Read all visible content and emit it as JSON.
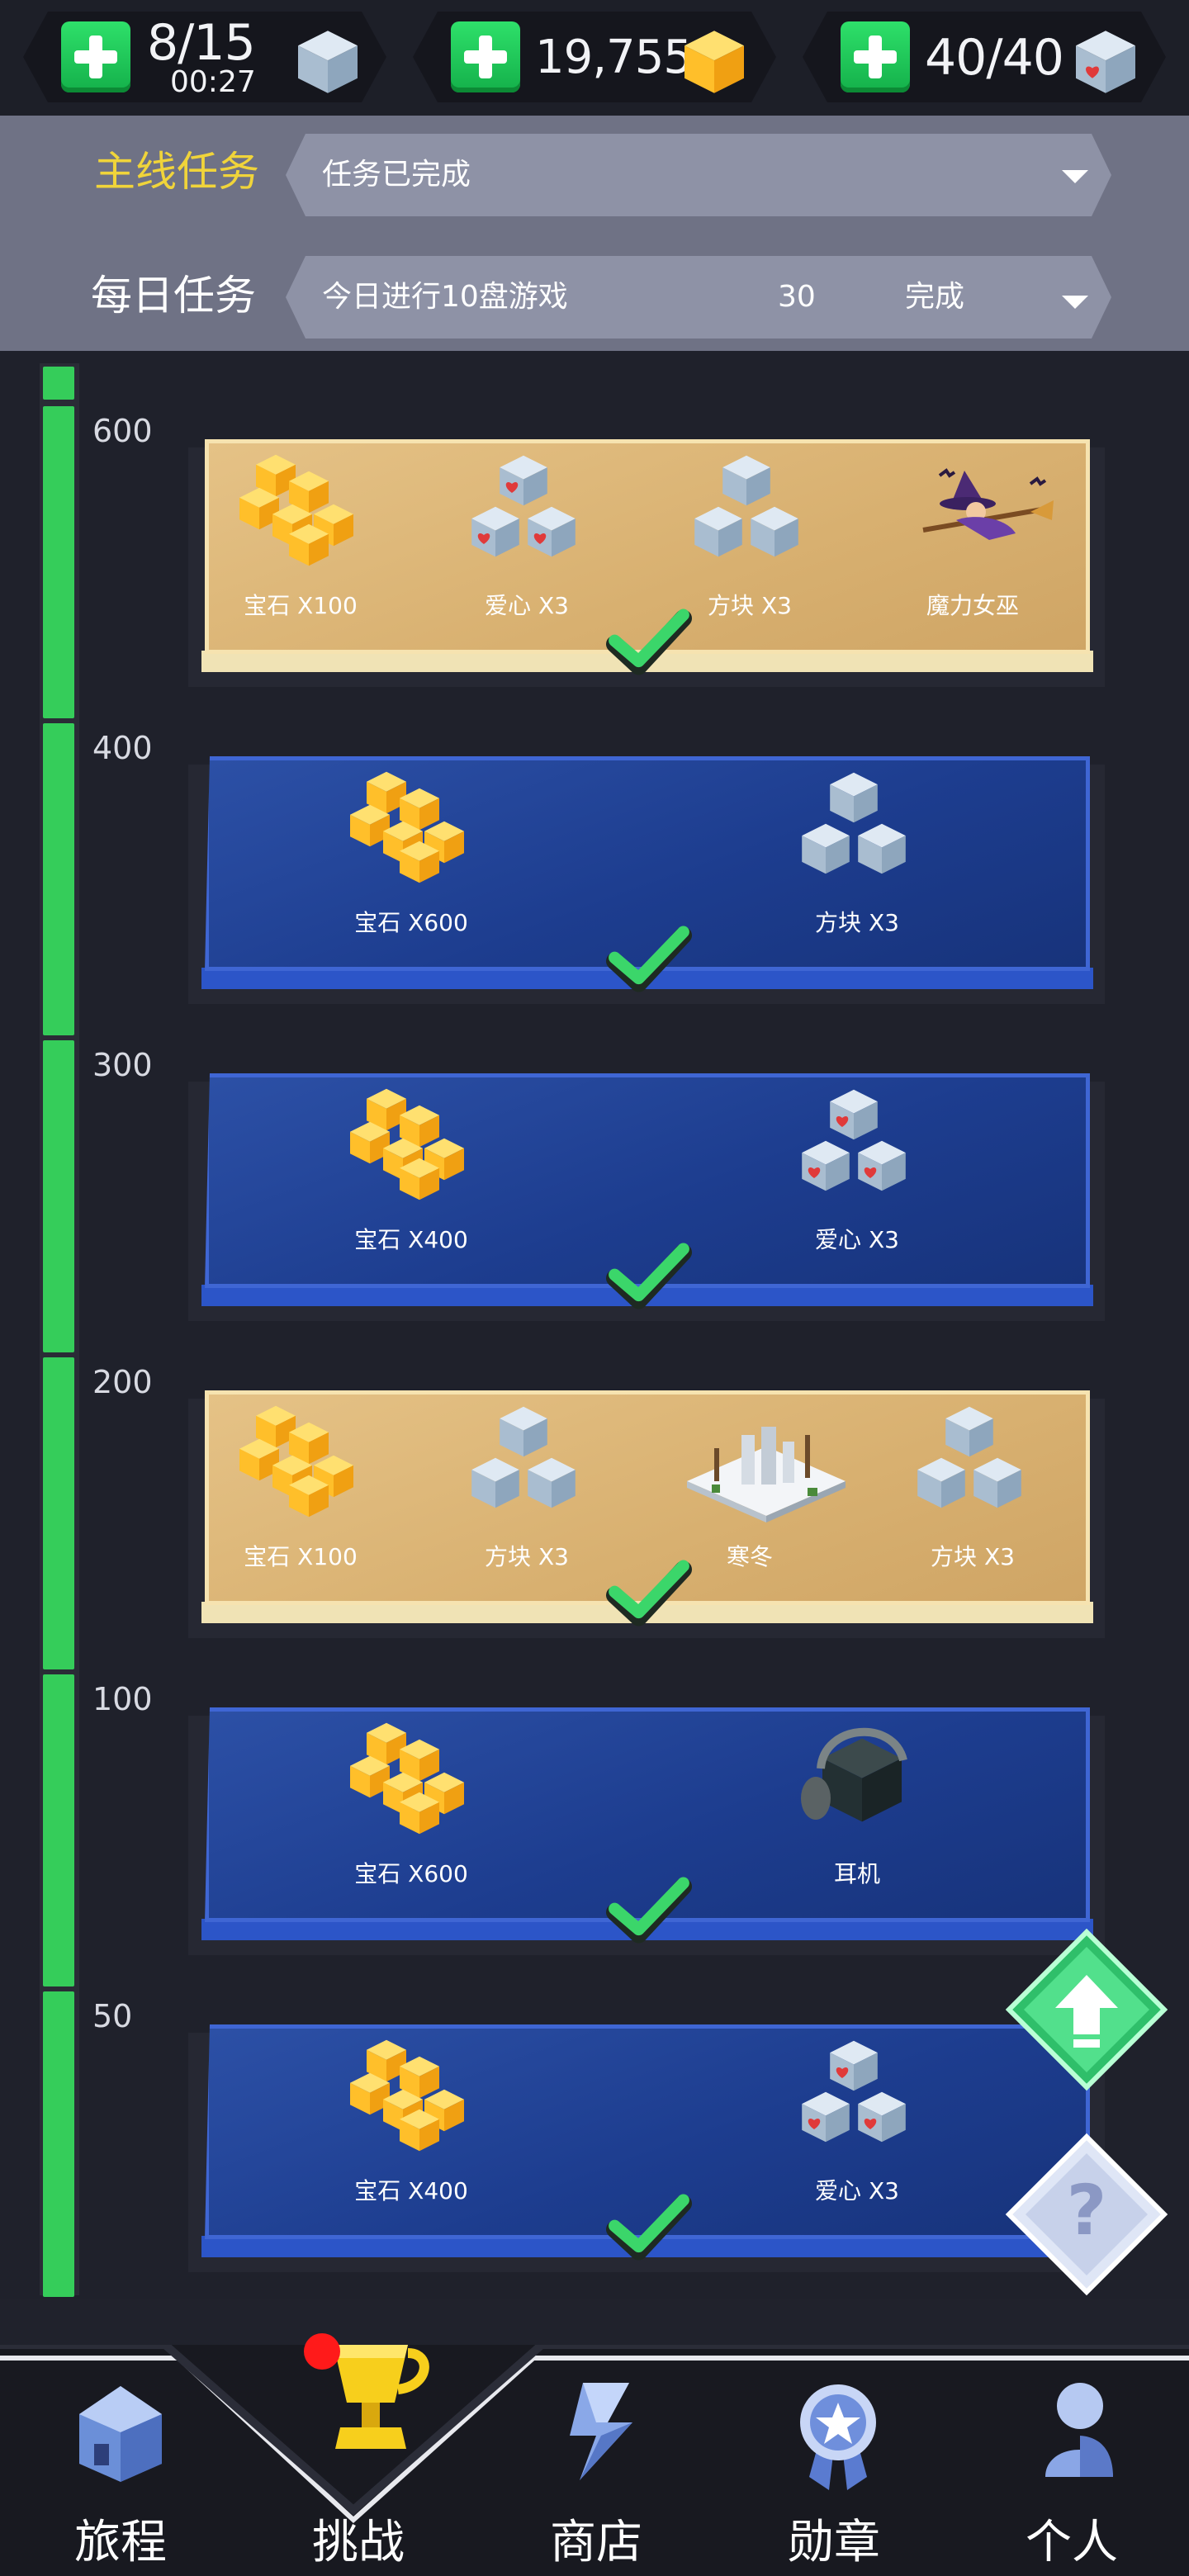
{
  "status_bar": {
    "energy": {
      "value": "8/15",
      "timer": "00:27",
      "icon": "ice-cube-icon"
    },
    "gems": {
      "value": "19,755",
      "icon": "gold-gem-icon"
    },
    "hearts": {
      "value": "40/40",
      "icon": "heart-cube-icon"
    }
  },
  "tasks": {
    "main": {
      "label": "主线任务",
      "status": "任务已完成"
    },
    "daily": {
      "label": "每日任务",
      "status": "今日进行10盘游戏",
      "count": "30",
      "state": "完成"
    }
  },
  "colors": {
    "accent_yellow": "#f0d43a",
    "progress_green": "#35cd5a",
    "card_blue": "#1d3d8f",
    "card_gold": "#d8b070"
  },
  "milestones": [
    {
      "points": "600",
      "style": "gold",
      "rewards": [
        {
          "icon": "gem-pile-icon",
          "label": "宝石 X100"
        },
        {
          "icon": "heart-cube-icon",
          "label": "爱心 X3"
        },
        {
          "icon": "ice-cube-icon",
          "label": "方块 X3"
        },
        {
          "icon": "witch-icon",
          "label": "魔力女巫"
        }
      ]
    },
    {
      "points": "400",
      "style": "blue",
      "rewards": [
        {
          "icon": "gem-pile-icon",
          "label": "宝石 X600"
        },
        {
          "icon": "ice-cube-icon",
          "label": "方块 X3"
        }
      ]
    },
    {
      "points": "300",
      "style": "blue",
      "rewards": [
        {
          "icon": "gem-pile-icon",
          "label": "宝石 X400"
        },
        {
          "icon": "heart-cube-icon",
          "label": "爱心 X3"
        }
      ]
    },
    {
      "points": "200",
      "style": "gold",
      "rewards": [
        {
          "icon": "gem-pile-icon",
          "label": "宝石 X100"
        },
        {
          "icon": "ice-cube-icon",
          "label": "方块 X3"
        },
        {
          "icon": "winter-scene-icon",
          "label": "寒冬"
        },
        {
          "icon": "ice-cube-icon",
          "label": "方块 X3"
        }
      ]
    },
    {
      "points": "100",
      "style": "blue",
      "rewards": [
        {
          "icon": "gem-pile-icon",
          "label": "宝石 X600"
        },
        {
          "icon": "headphones-icon",
          "label": "耳机"
        }
      ]
    },
    {
      "points": "50",
      "style": "blue",
      "rewards": [
        {
          "icon": "gem-pile-icon",
          "label": "宝石 X400"
        },
        {
          "icon": "heart-cube-icon",
          "label": "爱心 X3"
        }
      ]
    }
  ],
  "side_buttons": {
    "upgrade": "up-arrow-icon",
    "help": "?"
  },
  "nav": {
    "items": [
      {
        "label": "旅程",
        "icon": "house-icon"
      },
      {
        "label": "挑战",
        "icon": "trophy-icon",
        "active": true
      },
      {
        "label": "商店",
        "icon": "shop-s-icon"
      },
      {
        "label": "勋章",
        "icon": "medal-icon"
      },
      {
        "label": "个人",
        "icon": "person-icon"
      }
    ]
  }
}
